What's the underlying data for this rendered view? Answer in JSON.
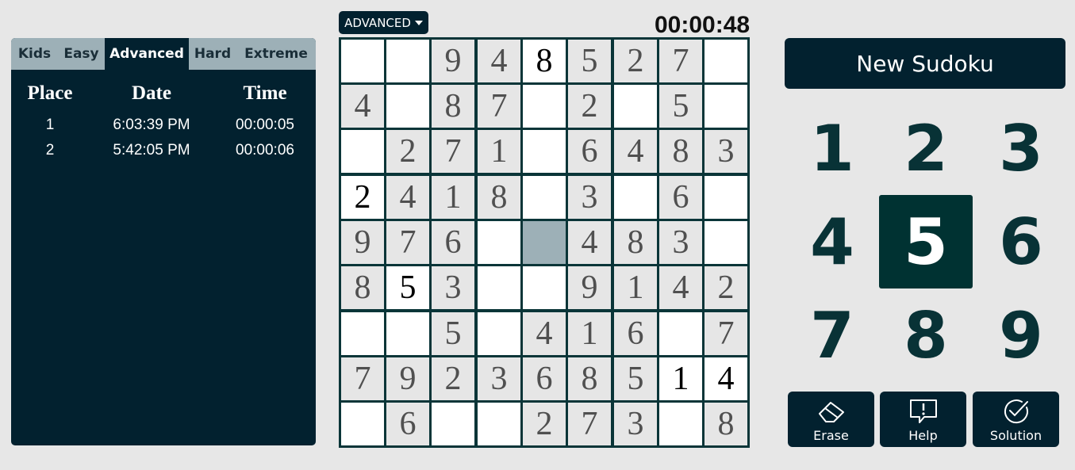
{
  "leaderboard": {
    "tabs": [
      {
        "label": "Kids",
        "active": false
      },
      {
        "label": "Easy",
        "active": false
      },
      {
        "label": "Advanced",
        "active": true
      },
      {
        "label": "Hard",
        "active": false
      },
      {
        "label": "Extreme",
        "active": false
      }
    ],
    "headers": {
      "place": "Place",
      "date": "Date",
      "time": "Time"
    },
    "rows": [
      {
        "place": "1",
        "date": "6:03:39 PM",
        "time": "00:00:05"
      },
      {
        "place": "2",
        "date": "5:42:05 PM",
        "time": "00:00:06"
      }
    ]
  },
  "difficulty_dropdown": {
    "label": "ADVANCED"
  },
  "timer": "00:00:48",
  "grid": {
    "rows": [
      [
        [
          " ",
          "e"
        ],
        [
          " ",
          "e"
        ],
        [
          "9",
          "g"
        ],
        [
          "4",
          "g"
        ],
        [
          "8",
          "u"
        ],
        [
          "5",
          "g"
        ],
        [
          "2",
          "g"
        ],
        [
          "7",
          "g"
        ],
        [
          " ",
          "e"
        ]
      ],
      [
        [
          "4",
          "g"
        ],
        [
          " ",
          "e"
        ],
        [
          "8",
          "g"
        ],
        [
          "7",
          "g"
        ],
        [
          " ",
          "e"
        ],
        [
          "2",
          "g"
        ],
        [
          " ",
          "e"
        ],
        [
          "5",
          "g"
        ],
        [
          " ",
          "e"
        ]
      ],
      [
        [
          " ",
          "e"
        ],
        [
          "2",
          "g"
        ],
        [
          "7",
          "g"
        ],
        [
          "1",
          "g"
        ],
        [
          " ",
          "e"
        ],
        [
          "6",
          "g"
        ],
        [
          "4",
          "g"
        ],
        [
          "8",
          "g"
        ],
        [
          "3",
          "g"
        ]
      ],
      [
        [
          "2",
          "u"
        ],
        [
          "4",
          "g"
        ],
        [
          "1",
          "g"
        ],
        [
          "8",
          "g"
        ],
        [
          " ",
          "e"
        ],
        [
          "3",
          "g"
        ],
        [
          " ",
          "e"
        ],
        [
          "6",
          "g"
        ],
        [
          " ",
          "e"
        ]
      ],
      [
        [
          "9",
          "g"
        ],
        [
          "7",
          "g"
        ],
        [
          "6",
          "g"
        ],
        [
          " ",
          "e"
        ],
        [
          " ",
          "s"
        ],
        [
          "4",
          "g"
        ],
        [
          "8",
          "g"
        ],
        [
          "3",
          "g"
        ],
        [
          " ",
          "e"
        ]
      ],
      [
        [
          "8",
          "g"
        ],
        [
          "5",
          "u"
        ],
        [
          "3",
          "g"
        ],
        [
          " ",
          "e"
        ],
        [
          " ",
          "e"
        ],
        [
          "9",
          "g"
        ],
        [
          "1",
          "g"
        ],
        [
          "4",
          "g"
        ],
        [
          "2",
          "g"
        ]
      ],
      [
        [
          " ",
          "e"
        ],
        [
          " ",
          "e"
        ],
        [
          "5",
          "g"
        ],
        [
          " ",
          "e"
        ],
        [
          "4",
          "g"
        ],
        [
          "1",
          "g"
        ],
        [
          "6",
          "g"
        ],
        [
          " ",
          "e"
        ],
        [
          "7",
          "g"
        ]
      ],
      [
        [
          "7",
          "g"
        ],
        [
          "9",
          "g"
        ],
        [
          "2",
          "g"
        ],
        [
          "3",
          "g"
        ],
        [
          "6",
          "g"
        ],
        [
          "8",
          "g"
        ],
        [
          "5",
          "g"
        ],
        [
          "1",
          "u"
        ],
        [
          "4",
          "u"
        ]
      ],
      [
        [
          " ",
          "e"
        ],
        [
          "6",
          "g"
        ],
        [
          " ",
          "e"
        ],
        [
          " ",
          "e"
        ],
        [
          "2",
          "g"
        ],
        [
          "7",
          "g"
        ],
        [
          "3",
          "g"
        ],
        [
          " ",
          "e"
        ],
        [
          "8",
          "g"
        ]
      ]
    ]
  },
  "new_game_button": {
    "label": "New Sudoku"
  },
  "number_pad": {
    "numbers": [
      "1",
      "2",
      "3",
      "4",
      "5",
      "6",
      "7",
      "8",
      "9"
    ],
    "selected": "5"
  },
  "tools": {
    "erase": {
      "label": "Erase",
      "icon": "eraser-icon"
    },
    "help": {
      "label": "Help",
      "icon": "help-bubble-icon"
    },
    "solution": {
      "label": "Solution",
      "icon": "check-circle-icon"
    }
  },
  "colors": {
    "panel": "#02212f",
    "accent": "#003232",
    "given_cell": "#e6e6e6",
    "selected_cell": "#9db0b7"
  }
}
